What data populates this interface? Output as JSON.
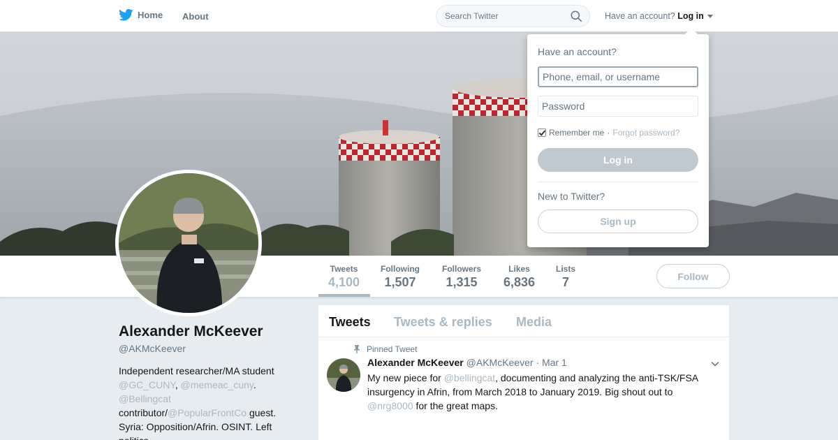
{
  "nav": {
    "home_label": "Home",
    "about_label": "About",
    "search_placeholder": "Search Twitter",
    "have_account_text": "Have an account?",
    "login_label": "Log in"
  },
  "colors": {
    "brand": "#1da1f2",
    "muted_link": "#aab8c2",
    "text": "#14171a",
    "secondary_text": "#657786"
  },
  "profile": {
    "name": "Alexander McKeever",
    "handle": "@AKMcKeever",
    "bio": [
      {
        "t": "Independent researcher/MA student ",
        "link": false
      },
      {
        "t": "@GC_CUNY",
        "link": true
      },
      {
        "t": ", ",
        "link": false
      },
      {
        "t": "@memeac_cuny",
        "link": true
      },
      {
        "t": ". ",
        "link": false
      },
      {
        "t": "@Bellingcat",
        "link": true
      },
      {
        "t": " contributor/",
        "link": false
      },
      {
        "t": "@PopularFrontCo",
        "link": true
      },
      {
        "t": " guest. Syria: Opposition/Afrin. OSINT. Left politics.",
        "link": false
      }
    ],
    "follow_label": "Follow"
  },
  "stats": [
    {
      "label": "Tweets",
      "value": "4,100",
      "active": true
    },
    {
      "label": "Following",
      "value": "1,507"
    },
    {
      "label": "Followers",
      "value": "1,315"
    },
    {
      "label": "Likes",
      "value": "6,836"
    },
    {
      "label": "Lists",
      "value": "7"
    }
  ],
  "timeline": {
    "tabs": [
      "Tweets",
      "Tweets & replies",
      "Media"
    ],
    "pinned_label": "Pinned Tweet",
    "tweet": {
      "author": "Alexander McKeever",
      "handle": "@AKMcKeever",
      "date": "· Mar 1",
      "text": [
        {
          "t": "My new piece for ",
          "link": false
        },
        {
          "t": "@bellingcat",
          "link": true
        },
        {
          "t": ", documenting and analyzing the anti-TSK/FSA insurgency in Afrin, from March 2018 to January 2019. Big shout out to ",
          "link": false
        },
        {
          "t": "@nrg8000",
          "link": true
        },
        {
          "t": " for the great maps.",
          "link": false
        }
      ]
    }
  },
  "login": {
    "title": "Have an account?",
    "username_placeholder": "Phone, email, or username",
    "password_placeholder": "Password",
    "remember_label": "Remember me",
    "separator": " · ",
    "forgot_label": "Forgot password?",
    "login_button": "Log in",
    "new_to": "New to Twitter?",
    "signup_button": "Sign up"
  }
}
